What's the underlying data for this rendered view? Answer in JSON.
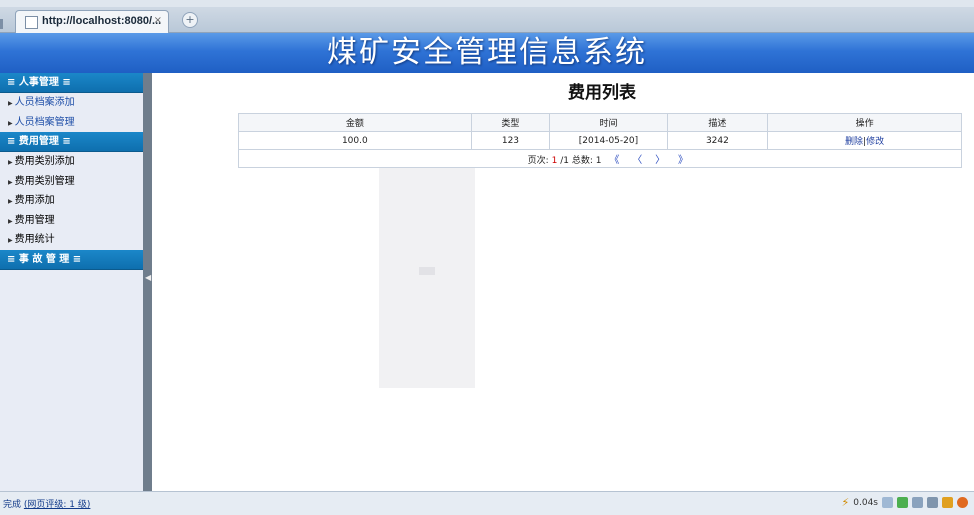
{
  "browser": {
    "tab_title": "http://localhost:8080/...",
    "tab_close": "×",
    "new_tab": "+"
  },
  "header": {
    "title": "煤矿安全管理信息系统"
  },
  "sidebar": {
    "groups": [
      {
        "label": "≡ 人事管理 ≡",
        "items": [
          "人员档案添加",
          "人员档案管理"
        ]
      },
      {
        "label": "≡ 费用管理 ≡",
        "items": [
          "费用类别添加",
          "费用类别管理",
          "费用添加",
          "费用管理",
          "费用统计"
        ]
      },
      {
        "label": "≡ 事 故 管 理 ≡",
        "items": []
      }
    ]
  },
  "main": {
    "title": "费用列表",
    "columns": [
      "金额",
      "类型",
      "时间",
      "描述",
      "操作"
    ],
    "rows": [
      {
        "amount": "100.0",
        "type": "123",
        "time": "[2014-05-20]",
        "desc": "3242",
        "delete": "删除",
        "sep": "|",
        "edit": "修改"
      }
    ],
    "pager": {
      "label": "页次:",
      "current": "1",
      "total": "/1",
      "count_label": "总数:",
      "count": "1",
      "first": "《",
      "prev": "〈",
      "next": "〉",
      "last": "》"
    }
  },
  "status": {
    "done": "完成",
    "rating": "(网页评级: 1 级)",
    "time": "0.04s"
  },
  "colors": {
    "header": "#2f73d6",
    "group_head": "#1b87c9",
    "link": "#1f3fa0"
  }
}
